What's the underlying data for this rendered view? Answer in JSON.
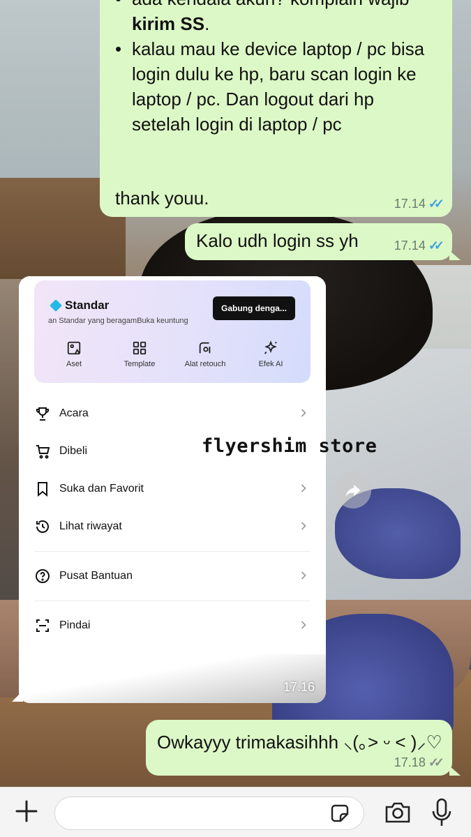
{
  "messages": {
    "main": {
      "bullets": [
        {
          "text": "ada kendala akun? komplain wajib ",
          "bold": "kirim SS",
          "after": "."
        },
        {
          "text": "kalau mau ke device laptop / pc bisa login dulu ke hp, baru scan login ke laptop / pc. Dan logout dari hp setelah login di laptop / pc"
        }
      ],
      "thanks": "thank youu.",
      "time": "17.14",
      "ticks": "✓✓"
    },
    "second": {
      "text": "Kalo udh login ss yh",
      "time": "17.14",
      "ticks": "✓✓"
    },
    "image": {
      "time": "17.16",
      "watermark": "flyershim store",
      "screenshot": {
        "card_title": "Standar",
        "card_subtitle": "an Standar yang beragamBuka keuntung",
        "join_button": "Gabung denga...",
        "tools": [
          {
            "label": "Aset",
            "icon": "image-icon"
          },
          {
            "label": "Template",
            "icon": "grid-icon"
          },
          {
            "label": "Alat retouch",
            "icon": "retouch-icon"
          },
          {
            "label": "Efek AI",
            "icon": "sparkle-icon"
          }
        ],
        "menu": [
          {
            "label": "Acara",
            "icon": "trophy-icon"
          },
          {
            "label": "Dibeli",
            "icon": "cart-icon"
          },
          {
            "label": "Suka dan Favorit",
            "icon": "bookmark-icon"
          },
          {
            "label": "Lihat riwayat",
            "icon": "history-icon"
          },
          {
            "label": "Pusat Bantuan",
            "icon": "help-icon"
          },
          {
            "label": "Pindai",
            "icon": "scan-icon"
          }
        ]
      }
    },
    "third": {
      "text": "Owkayyy trimakasihhh ⸜(｡˃ ᵕ ˂ )⸝♡",
      "time": "17.18",
      "ticks": "✓✓"
    }
  },
  "input": {
    "placeholder": ""
  },
  "colors": {
    "bubble": "#dcf8c6",
    "read_ticks": "#3da0e0",
    "card_gradient_end": "#d4dcfb"
  }
}
